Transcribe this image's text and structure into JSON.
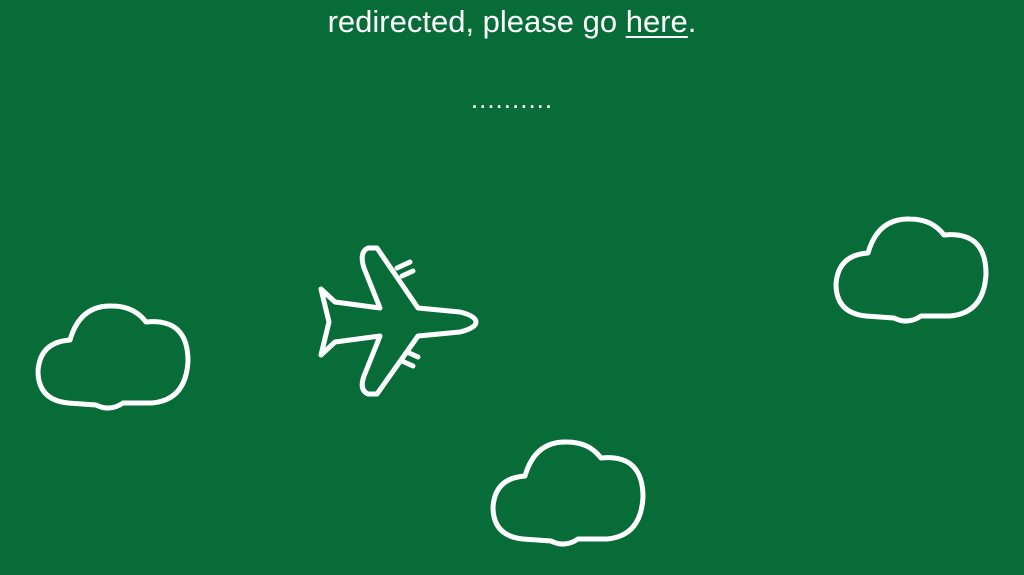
{
  "background_color": "#076c38",
  "redirect": {
    "text_before_link": "redirected, please go ",
    "link_label": "here",
    "text_after_link": "."
  },
  "loading_indicator": "..........",
  "icons": {
    "plane": "airplane-icon",
    "clouds": [
      "cloud-icon",
      "cloud-icon",
      "cloud-icon"
    ]
  }
}
